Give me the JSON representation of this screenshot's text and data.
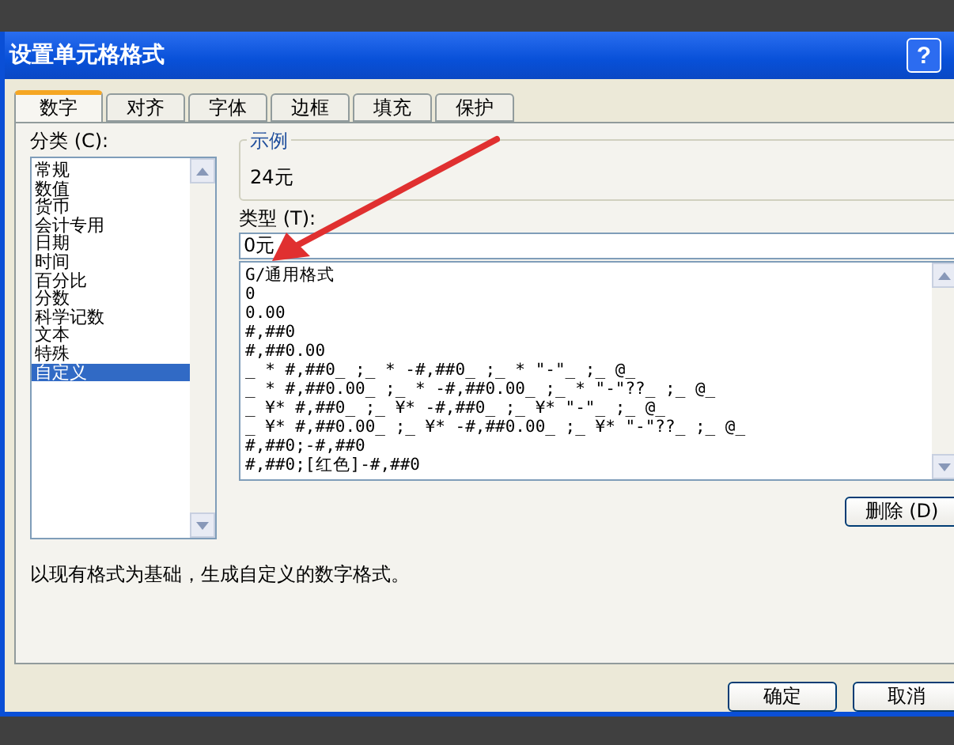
{
  "window": {
    "title": "设置单元格格式",
    "help": "?"
  },
  "tabs": [
    {
      "label": "数字",
      "selected": true
    },
    {
      "label": "对齐",
      "selected": false
    },
    {
      "label": "字体",
      "selected": false
    },
    {
      "label": "边框",
      "selected": false
    },
    {
      "label": "填充",
      "selected": false
    },
    {
      "label": "保护",
      "selected": false
    }
  ],
  "category": {
    "label": "分类 (C):",
    "items": [
      {
        "label": "常规",
        "selected": false
      },
      {
        "label": "数值",
        "selected": false
      },
      {
        "label": "货币",
        "selected": false
      },
      {
        "label": "会计专用",
        "selected": false
      },
      {
        "label": "日期",
        "selected": false
      },
      {
        "label": "时间",
        "selected": false
      },
      {
        "label": "百分比",
        "selected": false
      },
      {
        "label": "分数",
        "selected": false
      },
      {
        "label": "科学记数",
        "selected": false
      },
      {
        "label": "文本",
        "selected": false
      },
      {
        "label": "特殊",
        "selected": false
      },
      {
        "label": "自定义",
        "selected": true
      }
    ]
  },
  "sample": {
    "legend": "示例",
    "value": "24元"
  },
  "type": {
    "label": "类型 (T):",
    "value": "0元"
  },
  "formats": [
    "G/通用格式",
    "0",
    "0.00",
    "#,##0",
    "#,##0.00",
    "_ * #,##0_ ;_ * -#,##0_ ;_ * \"-\"_ ;_ @_",
    "_ * #,##0.00_ ;_ * -#,##0.00_ ;_ * \"-\"??_ ;_ @_",
    "_ ¥* #,##0_ ;_ ¥* -#,##0_ ;_ ¥* \"-\"_ ;_ @_",
    "_ ¥* #,##0.00_ ;_ ¥* -#,##0.00_ ;_ ¥* \"-\"??_ ;_ @_",
    "#,##0;-#,##0",
    "#,##0;[红色]-#,##0"
  ],
  "delete_button": "删除 (D)",
  "description": "以现有格式为基础，生成自定义的数字格式。",
  "buttons": [
    "确定",
    "取消"
  ]
}
